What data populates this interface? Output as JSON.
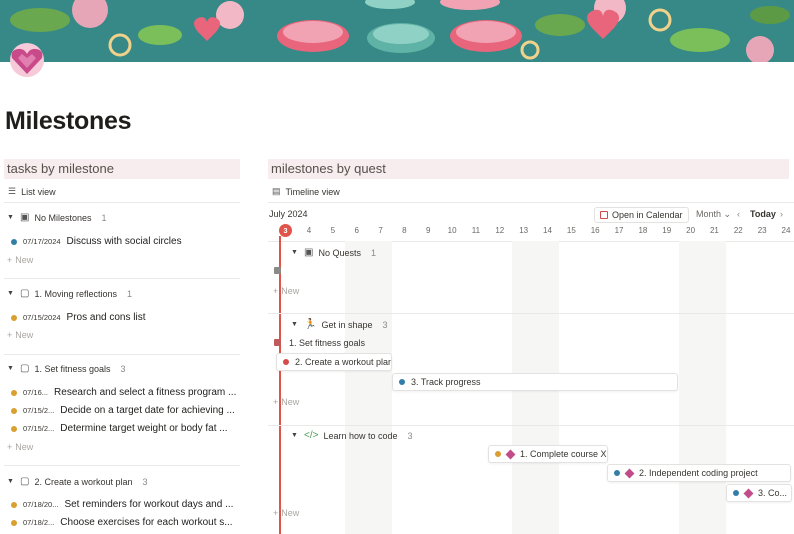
{
  "page": {
    "title": "Milestones"
  },
  "icons": {
    "page_icon": "heart-gem-icon"
  },
  "left": {
    "section_title": "tasks by milestone",
    "view_label": "List view",
    "new_label": "New",
    "groups": [
      {
        "title": "No Milestones",
        "count": "1",
        "icon": "inbox-icon",
        "tasks": [
          {
            "date": "07/17/2024",
            "name": "Discuss with social circles",
            "color": "blue"
          }
        ]
      },
      {
        "title": "1. Moving reflections",
        "count": "1",
        "icon": "page-icon",
        "tasks": [
          {
            "date": "07/15/2024",
            "name": "Pros and cons list",
            "color": "orange"
          }
        ]
      },
      {
        "title": "1. Set fitness goals",
        "count": "3",
        "icon": "page-icon",
        "tasks": [
          {
            "date": "07/16...",
            "name": "Research and select a fitness program ...",
            "color": "orange"
          },
          {
            "date": "07/15/2...",
            "name": "Decide on a target date for achieving ...",
            "color": "orange"
          },
          {
            "date": "07/15/2...",
            "name": "Determine target weight or body fat ...",
            "color": "orange"
          }
        ]
      },
      {
        "title": "2. Create a workout plan",
        "count": "3",
        "icon": "page-icon",
        "tasks": [
          {
            "date": "07/18/20...",
            "name": "Set reminders for workout days and ...",
            "color": "orange"
          },
          {
            "date": "07/18/2...",
            "name": "Choose exercises for each workout s...",
            "color": "orange"
          }
        ]
      }
    ]
  },
  "right": {
    "section_title": "milestones by quest",
    "view_label": "Timeline view",
    "month": "July 2024",
    "open_calendar": "Open in Calendar",
    "scale": "Month",
    "today_label": "Today",
    "today_day": "3",
    "days": [
      "4",
      "5",
      "6",
      "7",
      "8",
      "9",
      "10",
      "11",
      "12",
      "13",
      "14",
      "15",
      "16",
      "17",
      "18",
      "19",
      "20",
      "21",
      "22",
      "23",
      "24"
    ],
    "new_label": "New",
    "groups": [
      {
        "title": "No Quests",
        "count": "1",
        "icon": "inbox-icon"
      },
      {
        "title": "Get in shape",
        "count": "3",
        "icon": "runner-icon"
      },
      {
        "title": "Learn how to code",
        "count": "3",
        "icon": "code-icon"
      }
    ],
    "items": [
      {
        "name": "1. Set fitness goals"
      },
      {
        "name": "2. Create a workout plan"
      },
      {
        "name": "3. Track progress"
      },
      {
        "name": "1. Complete course X"
      },
      {
        "name": "2. Independent coding project"
      },
      {
        "name": "3. Co..."
      }
    ]
  },
  "colors": {
    "accent_red": "#e0544a",
    "banner_teal": "#2f7f86",
    "milestone_pink": "#c14c8a",
    "dot_blue": "#337ea9",
    "dot_orange": "#d9a031"
  }
}
